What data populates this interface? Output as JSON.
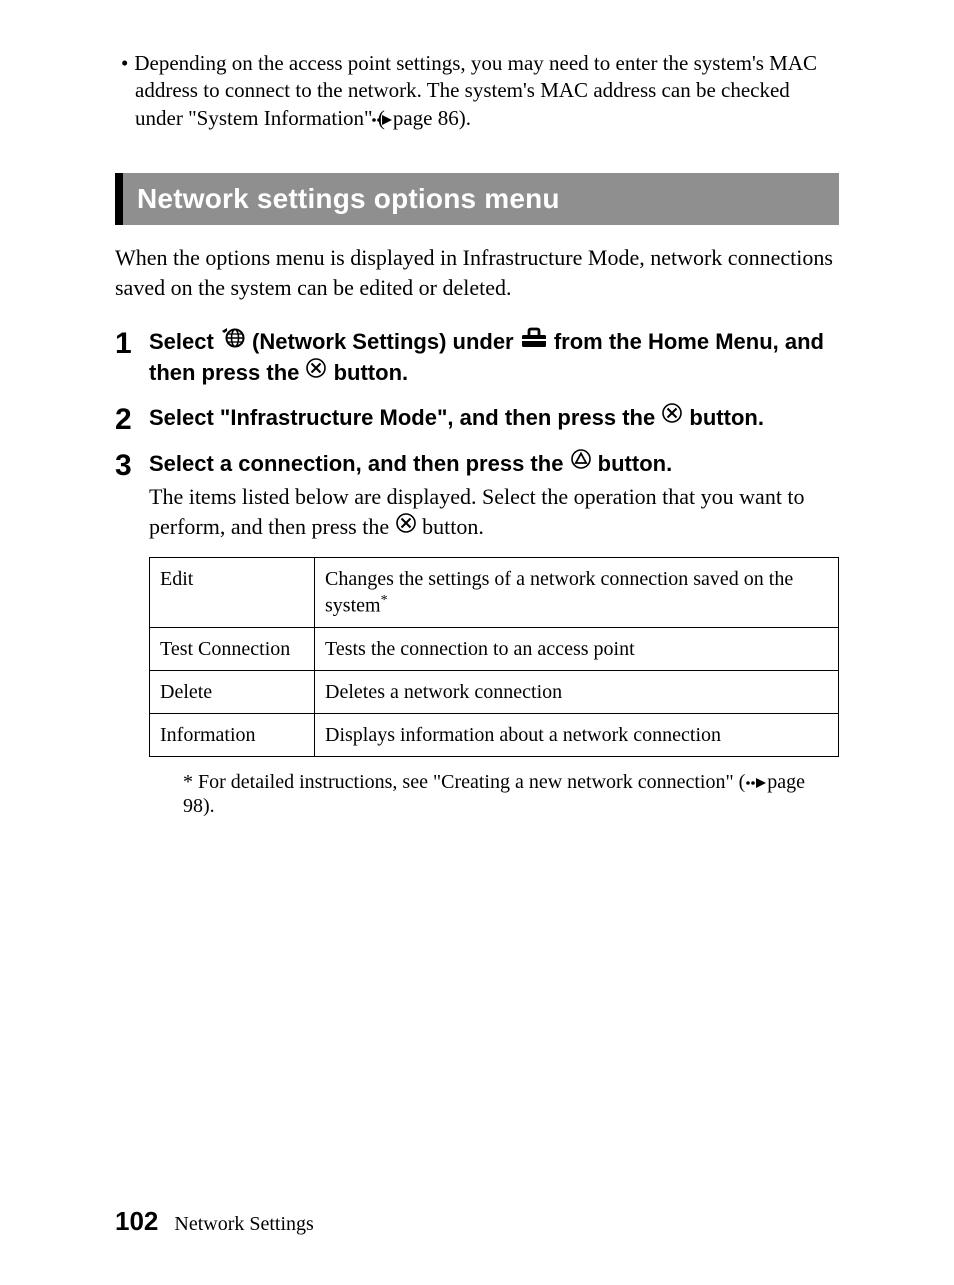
{
  "top_note": {
    "bullet": "•",
    "text_before_ref": "Depending on the access point settings, you may need to enter the system's MAC address to connect to the network. The system's MAC address can be checked under \"System Information\" (",
    "ref_page": "page 86",
    "text_after_ref": ")."
  },
  "section_title": "Network settings options menu",
  "intro": "When the options menu is displayed in Infrastructure Mode, network connections saved on the system can be edited or deleted.",
  "steps": [
    {
      "num": "1",
      "title_parts": {
        "a": "Select ",
        "b": " (Network Settings) under ",
        "c": " from the Home Menu, and then press the ",
        "d": " button."
      }
    },
    {
      "num": "2",
      "title_parts": {
        "a": "Select \"Infrastructure Mode\", and then press the ",
        "b": " button."
      }
    },
    {
      "num": "3",
      "title_parts": {
        "a": "Select a connection, and then press the ",
        "b": " button."
      },
      "desc_parts": {
        "a": "The items listed below are displayed. Select the operation that you want to perform, and then press the ",
        "b": " button."
      }
    }
  ],
  "table": {
    "rows": [
      {
        "name": "Edit",
        "desc": "Changes the settings of a network connection saved on the system",
        "has_star": true
      },
      {
        "name": "Test Connection",
        "desc": "Tests the connection to an access point",
        "has_star": false
      },
      {
        "name": "Delete",
        "desc": "Deletes a network connection",
        "has_star": false
      },
      {
        "name": "Information",
        "desc": "Displays information about a network connection",
        "has_star": false
      }
    ]
  },
  "table_footnote": {
    "star": "*",
    "before": " For detailed instructions, see \"Creating a new network connection\" (",
    "ref_page": "page 98",
    "after": ")."
  },
  "footer": {
    "page_number": "102",
    "section_name": "Network Settings"
  },
  "icons": {
    "network_settings": "network-settings-icon",
    "settings_toolbox": "settings-toolbox-icon",
    "x_button": "x-button-icon",
    "triangle_button": "triangle-button-icon",
    "reference_arrow": "reference-arrow-icon"
  }
}
